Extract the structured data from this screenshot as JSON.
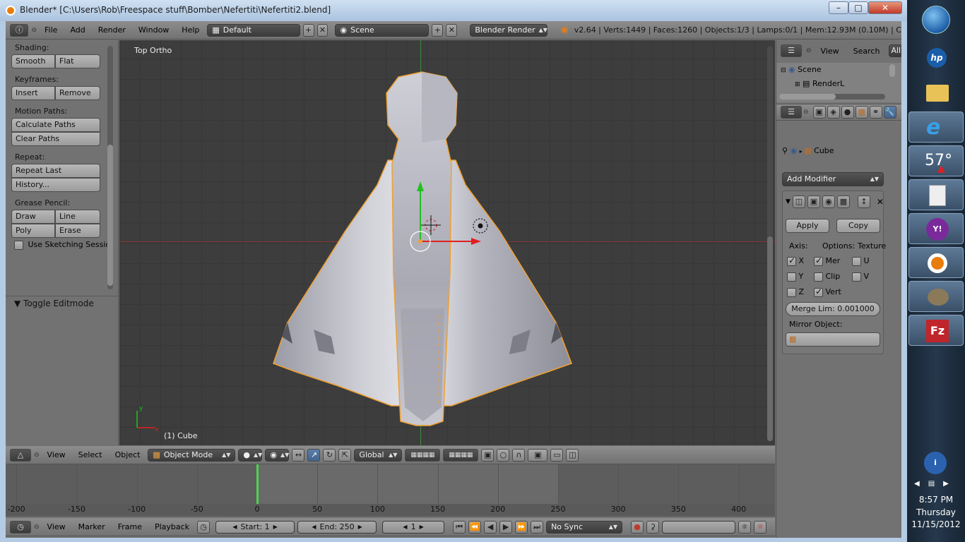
{
  "window": {
    "title": "Blender* [C:\\Users\\Rob\\Freespace stuff\\Bomber\\Nefertiti\\Nefertiti2.blend]"
  },
  "info_header": {
    "menus": [
      "File",
      "Add",
      "Render",
      "Window",
      "Help"
    ],
    "screen_layout": "Default",
    "scene": "Scene",
    "render_engine": "Blender Render",
    "stats": "v2.64 | Verts:1449 | Faces:1260 | Objects:1/3 | Lamps:0/1 | Mem:12.93M (0.10M) | C"
  },
  "toolshelf": {
    "shading": {
      "label": "Shading:",
      "buttons": [
        "Smooth",
        "Flat"
      ]
    },
    "keyframes": {
      "label": "Keyframes:",
      "buttons": [
        "Insert",
        "Remove"
      ]
    },
    "motion_paths": {
      "label": "Motion Paths:",
      "buttons": [
        "Calculate Paths",
        "Clear Paths"
      ]
    },
    "repeat": {
      "label": "Repeat:",
      "buttons": [
        "Repeat Last",
        "History..."
      ]
    },
    "grease_pencil": {
      "label": "Grease Pencil:",
      "buttons": [
        "Draw",
        "Line",
        "Poly",
        "Erase"
      ]
    },
    "sketching": "Use Sketching Sessio",
    "toggle_editmode": "Toggle Editmode"
  },
  "viewport": {
    "view_label": "Top Ortho",
    "object_label": "(1) Cube"
  },
  "viewport_header": {
    "menus": [
      "View",
      "Select",
      "Object"
    ],
    "mode": "Object Mode",
    "orientation": "Global"
  },
  "outliner": {
    "menus": [
      "View",
      "Search"
    ],
    "filter": "All",
    "items": [
      "Scene",
      "RenderL"
    ]
  },
  "properties": {
    "object": "Cube",
    "add_modifier": "Add Modifier",
    "apply": "Apply",
    "copy": "Copy",
    "axis_label": "Axis:",
    "options_label": "Options:",
    "texture_label": "Texture",
    "axes": [
      {
        "label": "X",
        "checked": true
      },
      {
        "label": "Y",
        "checked": false
      },
      {
        "label": "Z",
        "checked": false
      }
    ],
    "options": [
      {
        "label": "Mer",
        "checked": true
      },
      {
        "label": "Clip",
        "checked": false
      },
      {
        "label": "Vert",
        "checked": true
      }
    ],
    "texture": [
      {
        "label": "U",
        "checked": false
      },
      {
        "label": "V",
        "checked": false
      }
    ],
    "merge_limit": "Merge Lim: 0.001000",
    "mirror_object_label": "Mirror Object:"
  },
  "timeline": {
    "ticks": [
      "-200",
      "-150",
      "-100",
      "-50",
      "0",
      "50",
      "100",
      "150",
      "200",
      "250",
      "300",
      "350",
      "400"
    ],
    "current_frame_value": 0,
    "menus": [
      "View",
      "Marker",
      "Frame",
      "Playback"
    ],
    "start": "Start: 1",
    "end": "End: 250",
    "current": "1",
    "sync": "No Sync"
  },
  "taskbar": {
    "weather": "57°",
    "time": "8:57 PM",
    "day": "Thursday",
    "date": "11/15/2012"
  },
  "colors": {
    "accent_orange": "#e87d0d",
    "selection_outline": "#f0a030",
    "x_axis": "#e02020",
    "y_axis": "#20c020",
    "timeline_cursor": "#4fd44f"
  }
}
